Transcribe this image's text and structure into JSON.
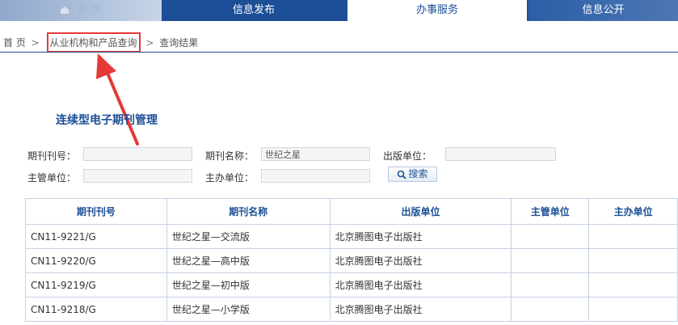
{
  "nav": {
    "home": "首 页",
    "info_release": "信息发布",
    "service": "办事服务",
    "info_public": "信息公开"
  },
  "breadcrumb": {
    "home": "首 页",
    "sep": ">",
    "item": "从业机构和产品查询",
    "current": "查询结果"
  },
  "page_title": "连续型电子期刊管理",
  "form": {
    "issn_label": "期刊刊号：",
    "issn_value": "",
    "name_label": "期刊名称：",
    "name_value": "世纪之星",
    "publisher_label": "出版单位：",
    "publisher_value": "",
    "supervisor_label": "主管单位：",
    "supervisor_value": "",
    "sponsor_label": "主办单位：",
    "sponsor_value": "",
    "search_label": "搜索"
  },
  "table": {
    "headers": [
      "期刊刊号",
      "期刊名称",
      "出版单位",
      "主管单位",
      "主办单位"
    ],
    "rows": [
      [
        "CN11-9221/G",
        "世纪之星—交流版",
        "北京腾图电子出版社",
        "",
        ""
      ],
      [
        "CN11-9220/G",
        "世纪之星—高中版",
        "北京腾图电子出版社",
        "",
        ""
      ],
      [
        "CN11-9219/G",
        "世纪之星—初中版",
        "北京腾图电子出版社",
        "",
        ""
      ],
      [
        "CN11-9218/G",
        "世纪之星—小学版",
        "北京腾图电子出版社",
        "",
        ""
      ]
    ]
  },
  "colors": {
    "nav_bg": "#1c4f97",
    "title": "#1c4f97",
    "highlight": "#e53935"
  }
}
